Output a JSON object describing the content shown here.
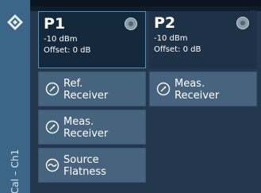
{
  "side": {
    "label": "Cal – Ch1"
  },
  "ports": [
    {
      "title": "P1",
      "power": "-10 dBm",
      "offset": "Offset: 0 dB"
    },
    {
      "title": "P2",
      "power": "-10 dBm",
      "offset": "Offset: 0 dB"
    }
  ],
  "buttons": {
    "ref_receiver": "Ref.\nReceiver",
    "meas_receiver_p1": "Meas.\nReceiver",
    "source_flatness": "Source\nFlatness",
    "meas_receiver_p2": "Meas.\nReceiver"
  },
  "icons": {
    "logo": "rs-logo-icon",
    "port_status": "port-status-icon",
    "gauge": "gauge-icon",
    "flatness": "flatness-icon"
  },
  "colors": {
    "side_strip": "#3c6688",
    "button": "#47647e",
    "selected_border": "#4a90c8"
  }
}
